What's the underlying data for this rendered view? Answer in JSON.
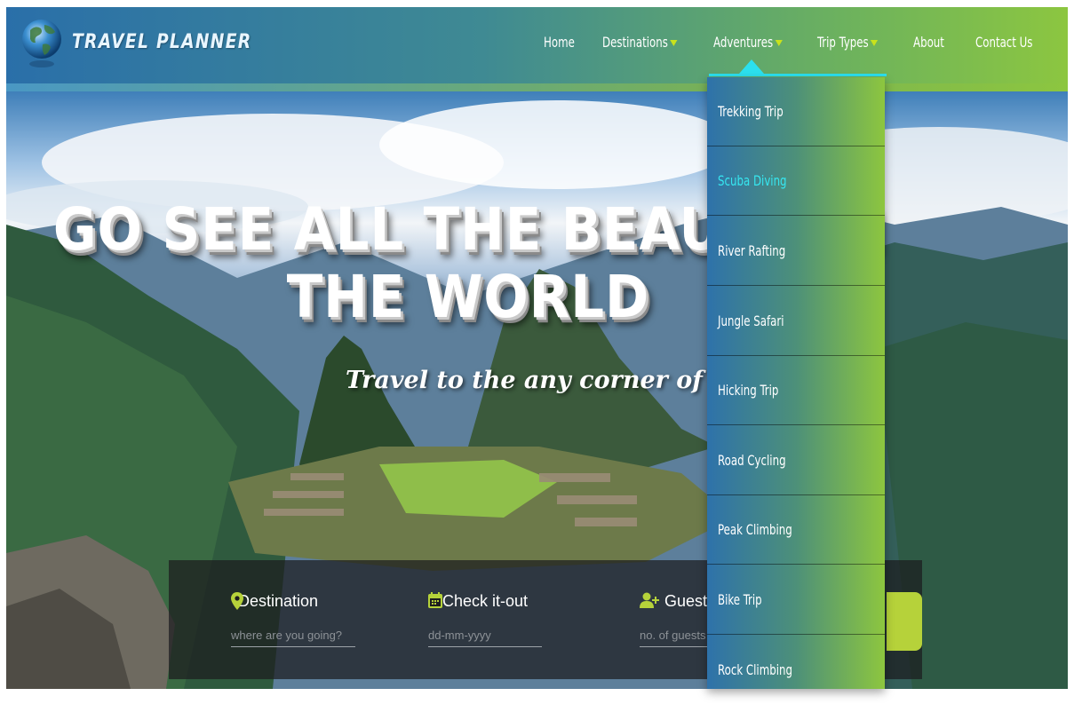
{
  "brand": {
    "name": "TRAVEL PLANNER",
    "logo_icon": "globe-icon"
  },
  "nav": {
    "items": [
      {
        "label": "Home",
        "has_caret": false
      },
      {
        "label": "Destinations",
        "has_caret": true
      },
      {
        "label": "Adventures",
        "has_caret": true,
        "active": true
      },
      {
        "label": "Trip Types",
        "has_caret": true
      },
      {
        "label": "About",
        "has_caret": false
      },
      {
        "label": "Contact Us",
        "has_caret": false
      }
    ],
    "caret_color": "#c9e21c",
    "active_color": "#2ce0ee"
  },
  "hero": {
    "title_line1": "GO SEE ALL THE BEAUTY IN",
    "title_line2": "THE WORLD",
    "subtitle": "Travel to the any corner of the world"
  },
  "booking": {
    "destination": {
      "label": "Destination",
      "placeholder": "where are you going?",
      "icon": "map-pin-icon"
    },
    "checkout": {
      "label": "Check it-out",
      "placeholder": "dd-mm-yyyy",
      "icon": "calendar-icon"
    },
    "guests": {
      "label": "Guests",
      "placeholder": "no. of guests",
      "icon": "add-user-icon"
    },
    "accent_color": "#b6d23a"
  },
  "adventures_menu": {
    "items": [
      {
        "label": "Trekking Trip"
      },
      {
        "label": "Scuba Diving",
        "hover": true
      },
      {
        "label": "River Rafting"
      },
      {
        "label": "Jungle Safari"
      },
      {
        "label": "Hicking Trip"
      },
      {
        "label": "Road Cycling"
      },
      {
        "label": "Peak Climbing"
      },
      {
        "label": "Bike Trip"
      },
      {
        "label": "Rock Climbing"
      }
    ],
    "hover_color": "#36e6f0"
  }
}
